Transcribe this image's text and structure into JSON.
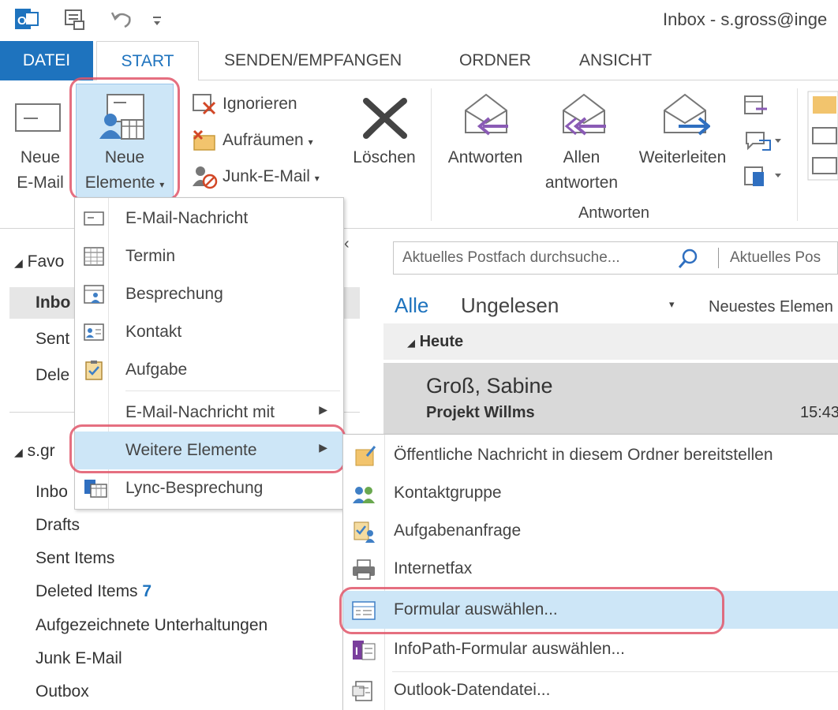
{
  "window": {
    "title": "Inbox - s.gross@inge"
  },
  "tabs": [
    "DATEI",
    "START",
    "SENDEN/EMPFANGEN",
    "ORDNER",
    "ANSICHT"
  ],
  "ribbon": {
    "neue_email": [
      "Neue",
      "E-Mail"
    ],
    "neue_elemente": [
      "Neue",
      "Elemente"
    ],
    "ignorieren": "Ignorieren",
    "aufraeumen": "Aufräumen",
    "junk": "Junk-E-Mail",
    "loeschen": "Löschen",
    "antworten": "Antworten",
    "allen_antworten": [
      "Allen",
      "antworten"
    ],
    "weiterleiten": "Weiterleiten",
    "group_antworten": "Antworten"
  },
  "search": {
    "placeholder": "Aktuelles Postfach durchsuche...",
    "scope": "Aktuelles Pos"
  },
  "filters": {
    "all": "Alle",
    "unread": "Ungelesen",
    "sort": "Neuestes Elemen"
  },
  "mail_list": {
    "group": "Heute",
    "items": [
      {
        "sender": "Groß, Sabine",
        "subject": "Projekt Willms",
        "time": "15:43"
      }
    ]
  },
  "nav": {
    "favorites_header": "Favo",
    "favorites": [
      "Inbo",
      "Sent",
      "Dele"
    ],
    "account_header": "s.gr",
    "folders": [
      {
        "name": "Inbo",
        "count": ""
      },
      {
        "name": "Drafts",
        "count": ""
      },
      {
        "name": "Sent Items",
        "count": ""
      },
      {
        "name": "Deleted Items",
        "count": "7"
      },
      {
        "name": "Aufgezeichnete Unterhaltungen",
        "count": ""
      },
      {
        "name": "Junk E-Mail",
        "count": ""
      },
      {
        "name": "Outbox",
        "count": ""
      }
    ]
  },
  "menu_new_items": [
    {
      "label": "E-Mail-Nachricht",
      "icon": "envelope-icon"
    },
    {
      "label": "Termin",
      "icon": "calendar-icon"
    },
    {
      "label": "Besprechung",
      "icon": "meeting-icon"
    },
    {
      "label": "Kontakt",
      "icon": "contact-card-icon"
    },
    {
      "label": "Aufgabe",
      "icon": "task-clipboard-icon"
    },
    {
      "label": "E-Mail-Nachricht mit",
      "icon": "",
      "submenu": true
    },
    {
      "label": "Weitere Elemente",
      "icon": "",
      "submenu": true
    },
    {
      "label": "Lync-Besprechung",
      "icon": "lync-meeting-icon"
    }
  ],
  "menu_more_items": [
    {
      "label": "Öffentliche Nachricht in diesem Ordner bereitstellen",
      "icon": "post-icon"
    },
    {
      "label": "Kontaktgruppe",
      "icon": "contact-group-icon"
    },
    {
      "label": "Aufgabenanfrage",
      "icon": "task-request-icon"
    },
    {
      "label": "Internetfax",
      "icon": "fax-icon"
    },
    {
      "label": "Formular auswählen...",
      "icon": "form-icon"
    },
    {
      "label": "InfoPath-Formular auswählen...",
      "icon": "infopath-icon"
    },
    {
      "label": "Outlook-Datendatei...",
      "icon": "data-file-icon"
    }
  ],
  "colors": {
    "accent": "#1e73be",
    "highlight": "#cde6f7",
    "annotation": "#e0566a",
    "selected_mail": "#d9d9d9"
  }
}
